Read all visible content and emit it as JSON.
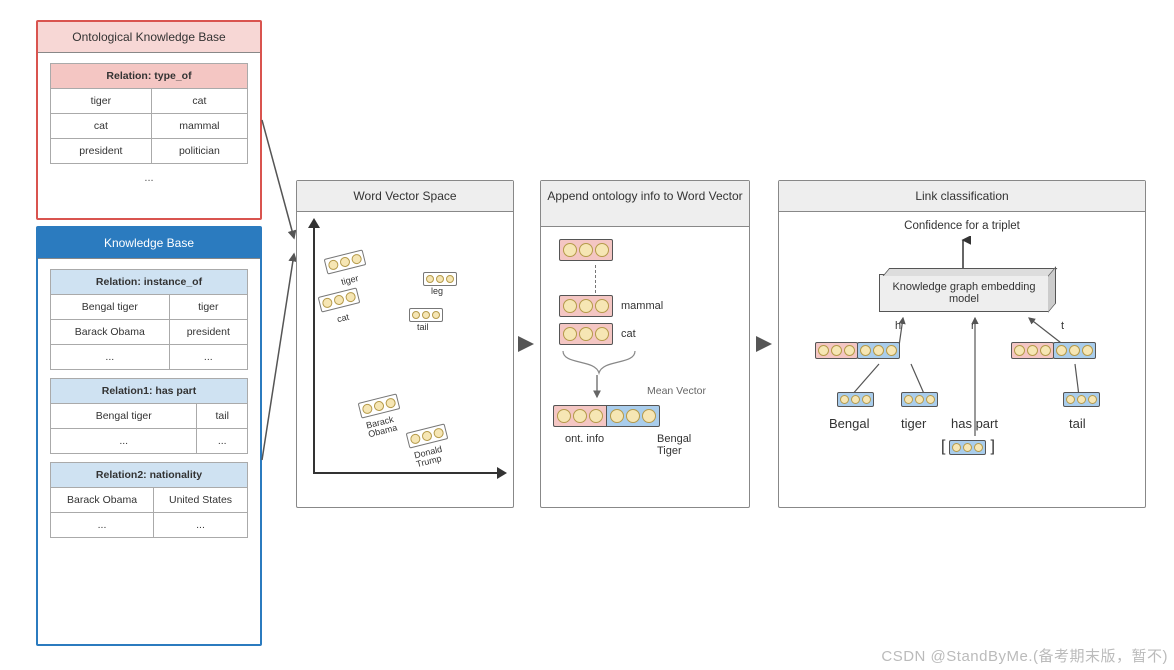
{
  "okb": {
    "title": "Ontological Knowledge Base",
    "relation": "Relation: type_of",
    "rows": [
      [
        "tiger",
        "cat"
      ],
      [
        "cat",
        "mammal"
      ],
      [
        "president",
        "politician"
      ]
    ],
    "ellipsis": "..."
  },
  "kb": {
    "title": "Knowledge Base",
    "tables": [
      {
        "relation": "Relation: instance_of",
        "rows": [
          [
            "Bengal tiger",
            "tiger"
          ],
          [
            "Barack Obama",
            "president"
          ],
          [
            "...",
            "..."
          ]
        ]
      },
      {
        "relation": "Relation1: has part",
        "rows": [
          [
            "Bengal tiger",
            "tail"
          ],
          [
            "...",
            "..."
          ]
        ]
      },
      {
        "relation": "Relation2: nationality",
        "rows": [
          [
            "Barack Obama",
            "United States"
          ],
          [
            "...",
            "..."
          ]
        ]
      }
    ]
  },
  "wvs": {
    "title": "Word Vector Space",
    "words": {
      "tiger": "tiger",
      "cat": "cat",
      "leg": "leg",
      "tail": "tail",
      "barack": "Barack\nObama",
      "donald": "Donald\nTrump"
    }
  },
  "append": {
    "title": "Append ontology info to Word Vector",
    "labels": {
      "mammal": "mammal",
      "cat": "cat",
      "mean": "Mean Vector",
      "ont": "ont. info",
      "bengal": "Bengal Tiger"
    }
  },
  "cls": {
    "title": "Link classification",
    "confidence": "Confidence for a triplet",
    "model": "Knowledge graph embedding model",
    "h": "h",
    "r": "r",
    "t": "t",
    "words": {
      "bengal": "Bengal",
      "tiger": "tiger",
      "haspart": "has part",
      "tail": "tail"
    },
    "bracket_l": "[",
    "bracket_r": "]"
  },
  "watermark": "CSDN @StandByMe.(备考期末版，暂不)"
}
